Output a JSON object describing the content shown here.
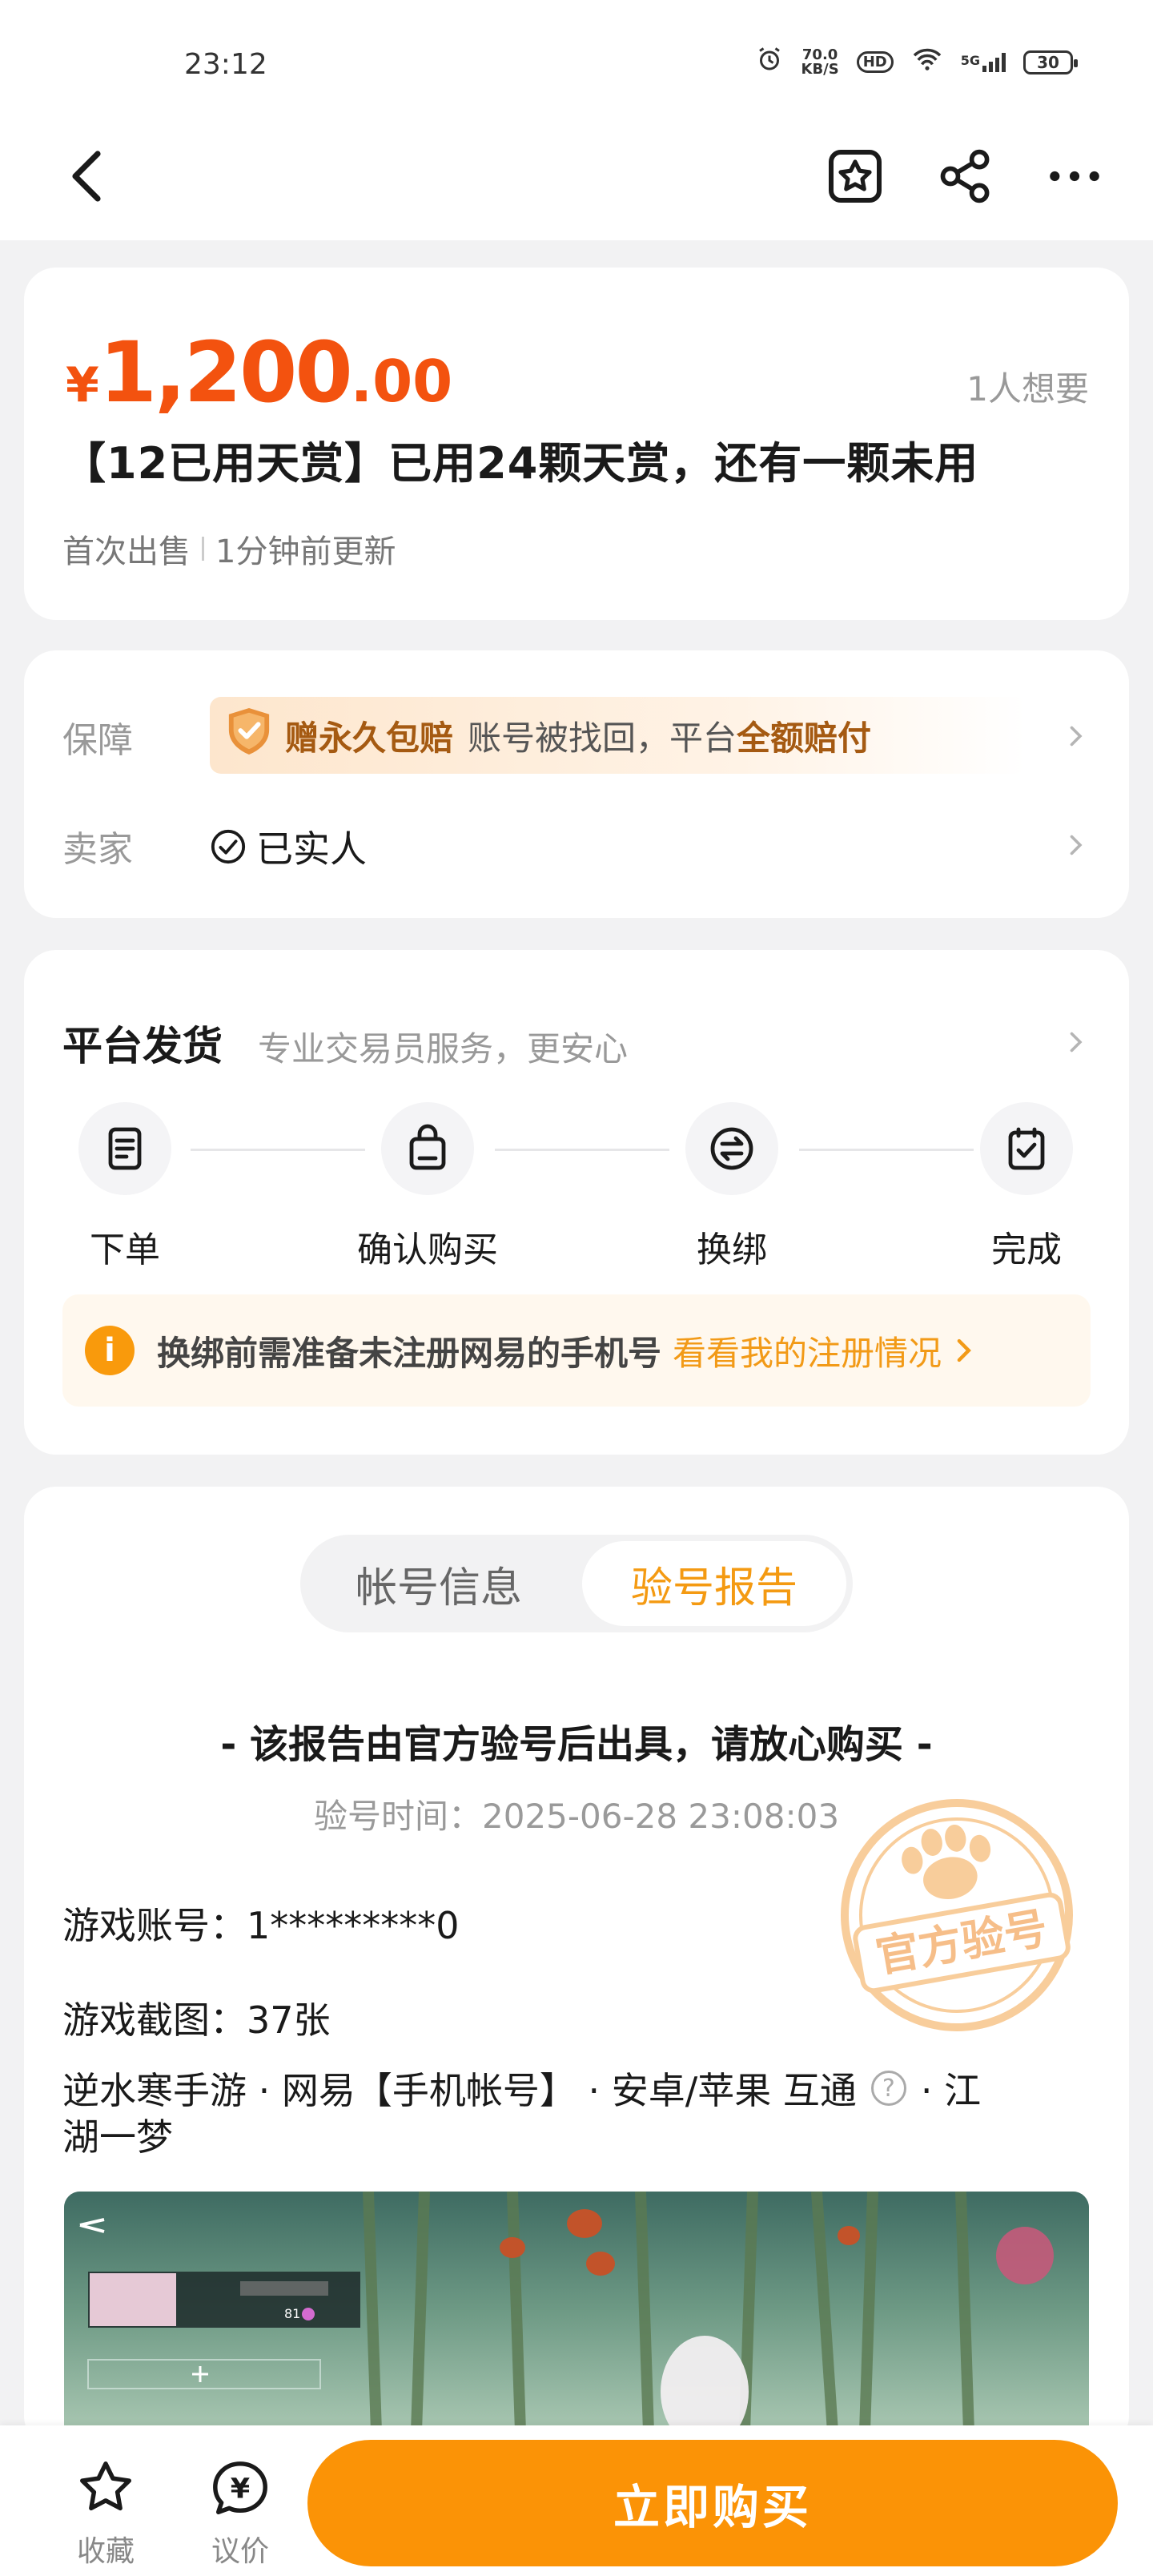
{
  "status_bar": {
    "time": "23:12",
    "speed_value": "70.0",
    "speed_unit": "KB/S",
    "hd": "HD",
    "network": "5G",
    "battery": "30"
  },
  "nav": {
    "back_icon": "chevron-left-icon",
    "favorite_icon": "star-box-icon",
    "share_icon": "share-icon",
    "more_icon": "more-dots-icon"
  },
  "product": {
    "currency": "¥",
    "price_integer": "1,200",
    "price_decimal": ".00",
    "wants": "1人想要",
    "title": "【12已用天赏】已用24颗天赏，还有一颗未用",
    "first_sale": "首次出售",
    "updated": "1分钟前更新"
  },
  "guarantee": {
    "label": "保障",
    "badge": "赠永久包赔",
    "text_prefix": "账号被找回，平台",
    "text_strong": "全额赔付"
  },
  "seller": {
    "label": "卖家",
    "value": "已实人"
  },
  "delivery": {
    "title": "平台发货",
    "subtitle": "专业交易员服务，更安心",
    "steps": [
      {
        "label": "下单",
        "icon": "order-icon"
      },
      {
        "label": "确认购买",
        "icon": "bag-icon"
      },
      {
        "label": "换绑",
        "icon": "swap-icon"
      },
      {
        "label": "完成",
        "icon": "check-icon"
      }
    ],
    "tip_text": "换绑前需准备未注册网易的手机号",
    "tip_link": "看看我的注册情况"
  },
  "report": {
    "tabs": [
      "帐号信息",
      "验号报告"
    ],
    "active_tab": "验号报告",
    "headline": "- 该报告由官方验号后出具，请放心购买 -",
    "time_label": "验号时间：",
    "time_value": "2025-06-28 23:08:03",
    "stamp_text": "官方验号",
    "account_label": "游戏账号：",
    "account_value": "1*********0",
    "screenshot_label": "游戏截图：",
    "screenshot_value": "37张",
    "game_line_1": "逆水寒手游 · 网易【手机帐号】 · 安卓/苹果 互通",
    "game_line_2": "· 江",
    "game_line_3": "湖一梦",
    "game_level": "81"
  },
  "bottom": {
    "favorite": "收藏",
    "bargain": "议价",
    "bargain_symbol": "¥",
    "buy": "立即购买"
  },
  "colors": {
    "price": "#f3520f",
    "accent": "#fb9306",
    "guarantee_text": "#a55a12"
  }
}
